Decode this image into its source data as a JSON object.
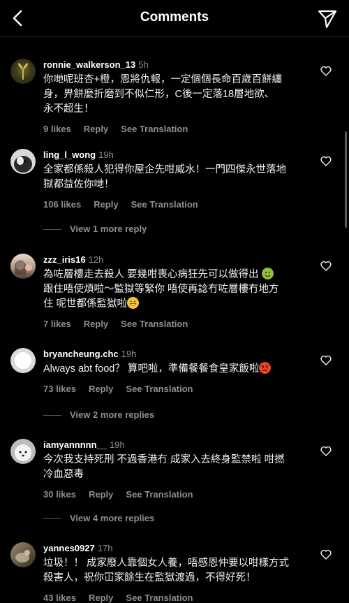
{
  "header": {
    "title": "Comments",
    "back_icon": "chevron-left-icon",
    "share_icon": "paper-plane-icon"
  },
  "actions_labels": {
    "reply": "Reply",
    "translate": "See Translation"
  },
  "comments": [
    {
      "username": "ronnie_walkerson_13",
      "time": "5h",
      "text": [
        "你哋呢班杏+橙，恩將仇報，一定個個長命百歲百餅纏",
        "身，畀餅麼折磨到不似仁形，C後一定落18層地欲、",
        "永不超生！"
      ],
      "likes": "9 likes"
    },
    {
      "username": "ling_l_wong",
      "time": "19h",
      "text": [
        "全家都係殺人犯得你屋企先咁威水！一門四傑永世落地",
        "獄都益佐你哋！"
      ],
      "likes": "106 likes",
      "view_more": "View 1 more reply"
    },
    {
      "username": "zzz_iris16",
      "time": "12h",
      "text": [
        "為咗層樓走去殺人 要幾咁喪心病狂先可以做得出",
        "跟住唔使煩啦～監獄等緊你 唔使再諗冇咗層樓冇地方",
        "住 呢世都係監獄啦"
      ],
      "likes": "7 likes"
    },
    {
      "username": "bryancheung.chc",
      "time": "19h",
      "text": [
        "Always abt food？ 算吧啦，準備餐餐食皇家飯啦"
      ],
      "likes": "73 likes",
      "view_more": "View 2 more replies"
    },
    {
      "username": "iamyannnnn__",
      "time": "19h",
      "text": [
        "今次我支持死刑 不過香港冇 成家入去終身監禁啦 咁撚",
        "冷血惡毒"
      ],
      "likes": "30 likes",
      "view_more": "View 4 more replies"
    },
    {
      "username": "yannes0927",
      "time": "17h",
      "text": [
        "垃圾！！ 成家廢人靠個女人養，唔感恩仲要以咁樣方式",
        "殺害人，祝你冚家餘生在監獄渡過，不得好死！"
      ],
      "likes": "43 likes"
    }
  ],
  "colors": {
    "background": "#000000",
    "text": "#f5f5f5",
    "muted": "#8e8e8e"
  }
}
